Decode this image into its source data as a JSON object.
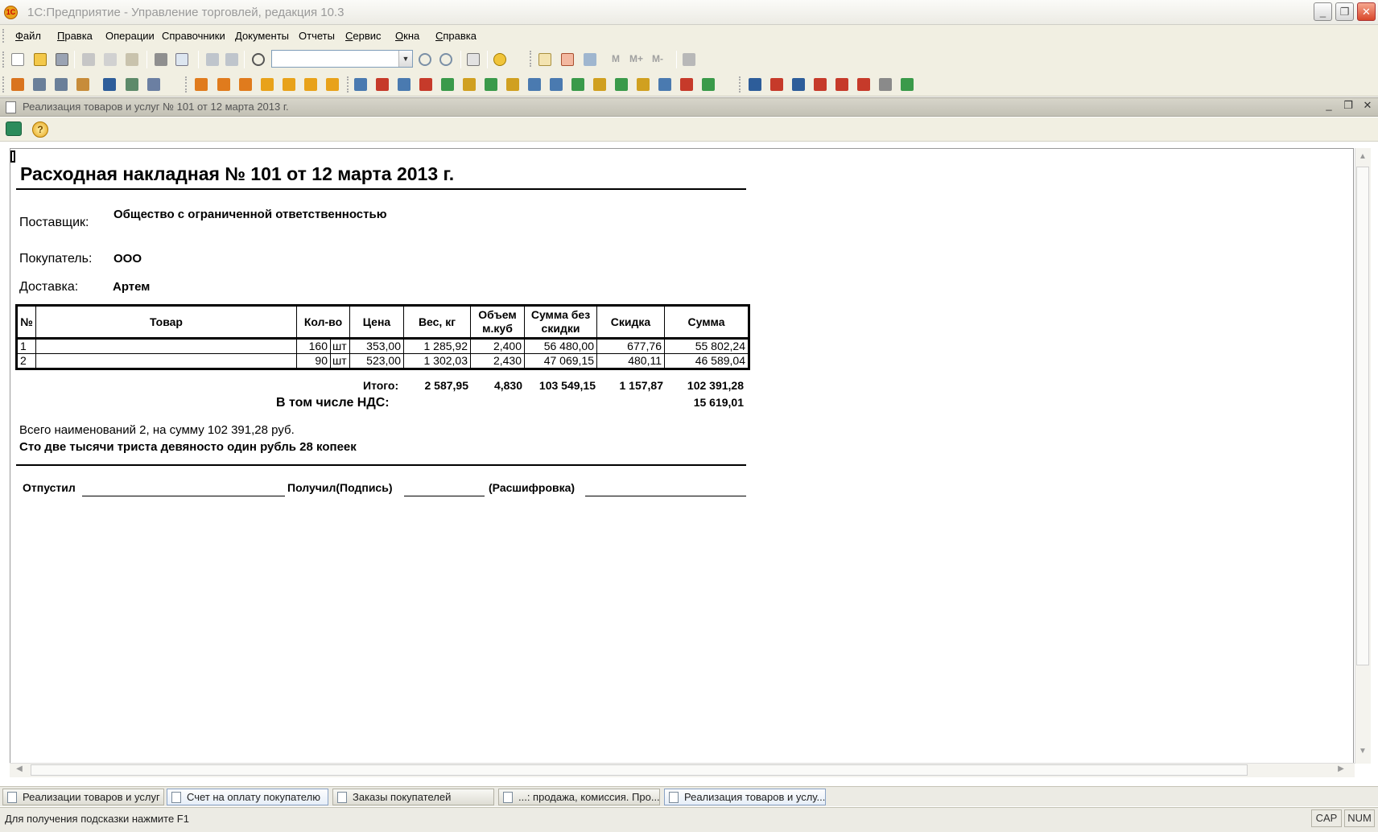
{
  "window": {
    "logo_text": "1С",
    "title": "1С:Предприятие - Управление торговлей, редакция 10.3",
    "minimize": "_",
    "restore": "❐",
    "close": "✕"
  },
  "menu": [
    {
      "first": "Ф",
      "rest": "айл"
    },
    {
      "first": "П",
      "rest": "равка"
    },
    {
      "first": "",
      "rest": "Операции"
    },
    {
      "first": "",
      "rest": "Справочники"
    },
    {
      "first": "",
      "rest": "Документы"
    },
    {
      "first": "",
      "rest": "Отчеты"
    },
    {
      "first": "С",
      "rest": "ервис"
    },
    {
      "first": "О",
      "rest": "кна"
    },
    {
      "first": "С",
      "rest": "правка"
    }
  ],
  "toolbar": {
    "search_value": "",
    "drop_arrow": "▼",
    "m_labels": [
      "M",
      "M+",
      "M-"
    ]
  },
  "document_window": {
    "title": "Реализация товаров и услуг № 101 от 12 марта 2013 г.",
    "minimize": "_",
    "restore": "❐",
    "close": "✕",
    "help_icon_text": "?"
  },
  "invoice": {
    "heading": "Расходная накладная № 101 от 12 марта 2013 г.",
    "supplier_label": "Поставщик:",
    "supplier_value": "Общество с ограниченной ответственностью",
    "buyer_label": "Покупатель:",
    "buyer_value": "ООО",
    "delivery_label": "Доставка:",
    "delivery_value": "Артем",
    "table": {
      "headers": [
        "№",
        "Товар",
        "Кол-во",
        "Цена",
        "Вес, кг",
        "Объем м.куб",
        "Сумма без скидки",
        "Скидка",
        "Сумма"
      ],
      "rows": [
        {
          "n": "1",
          "item": "",
          "qty": "160",
          "unit": "шт",
          "price": "353,00",
          "weight": "1 285,92",
          "volume": "2,400",
          "sum_no_discount": "56 480,00",
          "discount": "677,76",
          "sum": "55 802,24"
        },
        {
          "n": "2",
          "item": "",
          "qty": "90",
          "unit": "шт",
          "price": "523,00",
          "weight": "1 302,03",
          "volume": "2,430",
          "sum_no_discount": "47 069,15",
          "discount": "480,11",
          "sum": "46 589,04"
        }
      ]
    },
    "totals": {
      "label": "Итого:",
      "weight": "2 587,95",
      "volume": "4,830",
      "sum_no_discount": "103 549,15",
      "discount": "1 157,87",
      "sum": "102 391,28"
    },
    "vat": {
      "label": "В том числе НДС:",
      "value": "15 619,01"
    },
    "summary_line": "Всего наименований 2, на сумму 102 391,28 руб.",
    "amount_in_words": "Сто две тысячи триста девяносто один рубль 28 копеек",
    "signatures": {
      "released": "Отпустил",
      "received": "Получил(Подпись)",
      "decoding": "(Расшифровка)"
    }
  },
  "scroll": {
    "up": "▲",
    "down": "▼",
    "left": "◀",
    "right": "▶"
  },
  "taskbar": [
    {
      "label": "Реализации товаров и услуг",
      "active": false
    },
    {
      "label": "Счет на оплату покупателю",
      "active": true
    },
    {
      "label": "Заказы покупателей",
      "active": false
    },
    {
      "label": "...: продажа, комиссия. Про...",
      "active": false
    },
    {
      "label": "Реализация товаров и услу...",
      "active": true
    }
  ],
  "statusbar": {
    "hint": "Для получения подсказки нажмите F1",
    "cap": "CAP",
    "num": "NUM"
  }
}
